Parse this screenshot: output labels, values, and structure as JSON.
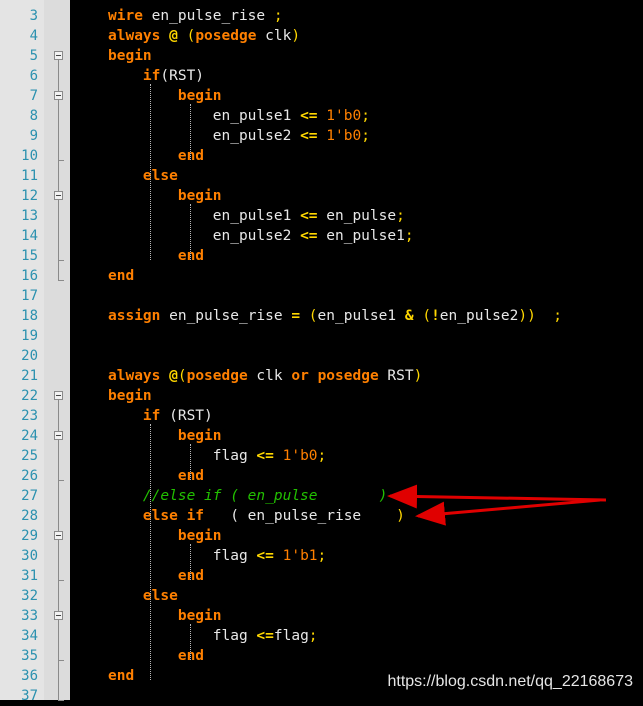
{
  "editor": {
    "lines": [
      {
        "n": "3",
        "tokens": [
          {
            "t": "wire",
            "c": "kw"
          },
          {
            "t": " en_pulse_rise ",
            "c": "id"
          },
          {
            "t": ";",
            "c": "pu"
          }
        ]
      },
      {
        "n": "4",
        "tokens": [
          {
            "t": "always",
            "c": "kw"
          },
          {
            "t": " ",
            "c": "id"
          },
          {
            "t": "@",
            "c": "op"
          },
          {
            "t": " (",
            "c": "pu"
          },
          {
            "t": "posedge",
            "c": "kw"
          },
          {
            "t": " clk",
            "c": "id"
          },
          {
            "t": ")",
            "c": "pu"
          }
        ]
      },
      {
        "n": "5",
        "tokens": [
          {
            "t": "begin",
            "c": "kw"
          }
        ]
      },
      {
        "n": "6",
        "tokens": [
          {
            "t": "    ",
            "c": "id"
          },
          {
            "t": "if",
            "c": "kw"
          },
          {
            "t": "(RST)",
            "c": "id"
          }
        ]
      },
      {
        "n": "7",
        "tokens": [
          {
            "t": "        ",
            "c": "id"
          },
          {
            "t": "begin",
            "c": "kw"
          }
        ]
      },
      {
        "n": "8",
        "tokens": [
          {
            "t": "            en_pulse1 ",
            "c": "id"
          },
          {
            "t": "<=",
            "c": "op"
          },
          {
            "t": " ",
            "c": "id"
          },
          {
            "t": "1'b0",
            "c": "num"
          },
          {
            "t": ";",
            "c": "pu"
          }
        ]
      },
      {
        "n": "9",
        "tokens": [
          {
            "t": "            en_pulse2 ",
            "c": "id"
          },
          {
            "t": "<=",
            "c": "op"
          },
          {
            "t": " ",
            "c": "id"
          },
          {
            "t": "1'b0",
            "c": "num"
          },
          {
            "t": ";",
            "c": "pu"
          }
        ]
      },
      {
        "n": "10",
        "tokens": [
          {
            "t": "        ",
            "c": "id"
          },
          {
            "t": "end",
            "c": "kw"
          }
        ]
      },
      {
        "n": "11",
        "tokens": [
          {
            "t": "    ",
            "c": "id"
          },
          {
            "t": "else",
            "c": "kw"
          }
        ]
      },
      {
        "n": "12",
        "tokens": [
          {
            "t": "        ",
            "c": "id"
          },
          {
            "t": "begin",
            "c": "kw"
          }
        ]
      },
      {
        "n": "13",
        "tokens": [
          {
            "t": "            en_pulse1 ",
            "c": "id"
          },
          {
            "t": "<=",
            "c": "op"
          },
          {
            "t": " en_pulse",
            "c": "id"
          },
          {
            "t": ";",
            "c": "pu"
          }
        ]
      },
      {
        "n": "14",
        "tokens": [
          {
            "t": "            en_pulse2 ",
            "c": "id"
          },
          {
            "t": "<=",
            "c": "op"
          },
          {
            "t": " en_pulse1",
            "c": "id"
          },
          {
            "t": ";",
            "c": "pu"
          }
        ]
      },
      {
        "n": "15",
        "tokens": [
          {
            "t": "        ",
            "c": "id"
          },
          {
            "t": "end",
            "c": "kw"
          }
        ]
      },
      {
        "n": "16",
        "tokens": [
          {
            "t": "end",
            "c": "kw"
          }
        ]
      },
      {
        "n": "17",
        "tokens": []
      },
      {
        "n": "18",
        "tokens": [
          {
            "t": "assign",
            "c": "kw"
          },
          {
            "t": " en_pulse_rise ",
            "c": "id"
          },
          {
            "t": "=",
            "c": "op"
          },
          {
            "t": " (",
            "c": "pu"
          },
          {
            "t": "en_pulse1 ",
            "c": "id"
          },
          {
            "t": "&",
            "c": "op"
          },
          {
            "t": " (",
            "c": "pu"
          },
          {
            "t": "!",
            "c": "op"
          },
          {
            "t": "en_pulse2",
            "c": "id"
          },
          {
            "t": "))",
            "c": "pu"
          },
          {
            "t": "  ;",
            "c": "pu"
          }
        ]
      },
      {
        "n": "19",
        "tokens": []
      },
      {
        "n": "20",
        "tokens": []
      },
      {
        "n": "21",
        "tokens": [
          {
            "t": "always",
            "c": "kw"
          },
          {
            "t": " ",
            "c": "id"
          },
          {
            "t": "@",
            "c": "op"
          },
          {
            "t": "(",
            "c": "pu"
          },
          {
            "t": "posedge",
            "c": "kw"
          },
          {
            "t": " clk ",
            "c": "id"
          },
          {
            "t": "or",
            "c": "kw"
          },
          {
            "t": " ",
            "c": "id"
          },
          {
            "t": "posedge",
            "c": "kw"
          },
          {
            "t": " RST",
            "c": "id"
          },
          {
            "t": ")",
            "c": "pu"
          }
        ]
      },
      {
        "n": "22",
        "tokens": [
          {
            "t": "begin",
            "c": "kw"
          }
        ]
      },
      {
        "n": "23",
        "tokens": [
          {
            "t": "    ",
            "c": "id"
          },
          {
            "t": "if",
            "c": "kw"
          },
          {
            "t": " (RST)",
            "c": "id"
          }
        ]
      },
      {
        "n": "24",
        "tokens": [
          {
            "t": "        ",
            "c": "id"
          },
          {
            "t": "begin",
            "c": "kw"
          }
        ]
      },
      {
        "n": "25",
        "tokens": [
          {
            "t": "            flag ",
            "c": "id"
          },
          {
            "t": "<=",
            "c": "op"
          },
          {
            "t": " ",
            "c": "id"
          },
          {
            "t": "1'b0",
            "c": "num"
          },
          {
            "t": ";",
            "c": "pu"
          }
        ]
      },
      {
        "n": "26",
        "tokens": [
          {
            "t": "        ",
            "c": "id"
          },
          {
            "t": "end",
            "c": "kw"
          }
        ]
      },
      {
        "n": "27",
        "tokens": [
          {
            "t": "    ",
            "c": "id"
          },
          {
            "t": "//else if ( en_pulse       )",
            "c": "cm"
          }
        ]
      },
      {
        "n": "28",
        "tokens": [
          {
            "t": "    ",
            "c": "id"
          },
          {
            "t": "else if",
            "c": "kw"
          },
          {
            "t": "   ( en_pulse_rise    ",
            "c": "id"
          },
          {
            "t": ")",
            "c": "pu"
          }
        ]
      },
      {
        "n": "29",
        "tokens": [
          {
            "t": "        ",
            "c": "id"
          },
          {
            "t": "begin",
            "c": "kw"
          }
        ]
      },
      {
        "n": "30",
        "tokens": [
          {
            "t": "            flag ",
            "c": "id"
          },
          {
            "t": "<=",
            "c": "op"
          },
          {
            "t": " ",
            "c": "id"
          },
          {
            "t": "1'b1",
            "c": "num"
          },
          {
            "t": ";",
            "c": "pu"
          }
        ]
      },
      {
        "n": "31",
        "tokens": [
          {
            "t": "        ",
            "c": "id"
          },
          {
            "t": "end",
            "c": "kw"
          }
        ]
      },
      {
        "n": "32",
        "tokens": [
          {
            "t": "    ",
            "c": "id"
          },
          {
            "t": "else",
            "c": "kw"
          }
        ]
      },
      {
        "n": "33",
        "tokens": [
          {
            "t": "        ",
            "c": "id"
          },
          {
            "t": "begin",
            "c": "kw"
          }
        ]
      },
      {
        "n": "34",
        "tokens": [
          {
            "t": "            flag ",
            "c": "id"
          },
          {
            "t": "<=",
            "c": "op"
          },
          {
            "t": "flag",
            "c": "id"
          },
          {
            "t": ";",
            "c": "pu"
          }
        ]
      },
      {
        "n": "35",
        "tokens": [
          {
            "t": "        ",
            "c": "id"
          },
          {
            "t": "end",
            "c": "kw"
          }
        ]
      },
      {
        "n": "36",
        "tokens": [
          {
            "t": "end",
            "c": "kw"
          }
        ]
      },
      {
        "n": "37",
        "tokens": []
      }
    ]
  },
  "watermark": "https://blog.csdn.net/qq_22168673",
  "colors": {
    "keyword": "#ff8000",
    "operator": "#ffd700",
    "comment": "#22c000",
    "identifier": "#e8e8e8",
    "line_number": "#2b91af",
    "annotation_arrow": "#e00000"
  },
  "annotations": [
    {
      "kind": "arrow",
      "target_line": "27",
      "color": "#e00000"
    },
    {
      "kind": "arrow",
      "target_line": "28",
      "color": "#e00000"
    }
  ]
}
